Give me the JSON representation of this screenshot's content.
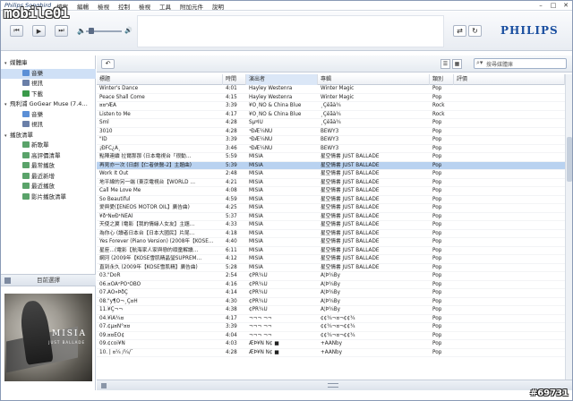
{
  "title": "Philips Songbird",
  "menu": [
    "檔案",
    "編輯",
    "檢視",
    "控制",
    "檢視",
    "工具",
    "附加元件",
    "說明"
  ],
  "watermark": "mobile01",
  "watermark_id": "#69731",
  "brand": "PHILIPS",
  "sidebar": {
    "tree": [
      {
        "label": "媒體庫",
        "level": 0,
        "expander": "▾"
      },
      {
        "label": "音樂",
        "level": 1,
        "selected": true,
        "icon_color": "#5b8fd6"
      },
      {
        "label": "視訊",
        "level": 1,
        "icon_color": "#6a7fa8"
      },
      {
        "label": "下載",
        "level": 1,
        "icon_color": "#3a9a4a"
      },
      {
        "label": "飛利浦 GoGear Muse (7.4…",
        "level": 0,
        "expander": "▾"
      },
      {
        "label": "音樂",
        "level": 1,
        "icon_color": "#5b8fd6"
      },
      {
        "label": "視訊",
        "level": 1,
        "icon_color": "#6a7fa8"
      },
      {
        "label": "播放清單",
        "level": 0,
        "expander": "▾"
      },
      {
        "label": "新歌單",
        "level": 1,
        "icon_color": "#5aa36a"
      },
      {
        "label": "高評價清單",
        "level": 1,
        "icon_color": "#5aa36a"
      },
      {
        "label": "最常播放",
        "level": 1,
        "icon_color": "#5aa36a"
      },
      {
        "label": "最近新增",
        "level": 1,
        "icon_color": "#5aa36a"
      },
      {
        "label": "最近播放",
        "level": 1,
        "icon_color": "#5aa36a"
      },
      {
        "label": "影片播放清單",
        "level": 1,
        "icon_color": "#5aa36a"
      }
    ],
    "now_selecting": "目前選擇",
    "album_text": "MISIA",
    "album_subtext": "JUST BALLADE"
  },
  "toolbar": {
    "back_label": "↶",
    "search_placeholder": "搜尋媒體庫"
  },
  "columns": [
    "標題",
    "時間",
    "演出者",
    "專輯",
    "類別",
    "評價"
  ],
  "rows": [
    [
      "Winter's Dance",
      "4:01",
      "Hayley Westenra",
      "Winter Magic",
      "Pop",
      ""
    ],
    [
      "Peace Shall Come",
      "4:15",
      "Hayley Westenra",
      "Winter Magic",
      "Pop",
      ""
    ],
    [
      "¤¤³ÆÀ",
      "3:39",
      "¥Ò¸ÑÖ & China Blue",
      "¸Çëãà¾",
      "Rock",
      ""
    ],
    [
      "Listen to Me",
      "4:17",
      "¥Ò¸ÑÖ & China Blue",
      "¸Çëãà¾",
      "Rock",
      ""
    ],
    [
      "Sml",
      "4:28",
      "SµºÎÚ",
      "¸Çëãà¾",
      "Pop",
      ""
    ],
    [
      "3010",
      "4:28",
      "¹ÐÆ¼ÑÚ",
      "BEWY3",
      "Pop",
      ""
    ],
    [
      "\"ÏD",
      "3:39",
      "¹ÐÆ¼ÑÚ",
      "BEWY3",
      "Pop",
      ""
    ],
    [
      "¡ÐFC¿Ã¸",
      "3:46",
      "¹ÐÆ¼ÑÚ",
      "BEWY3",
      "Pop",
      ""
    ],
    [
      "點陣連續 拉爾那那 (日本電視台「很動…",
      "5:59",
      "MISIA",
      "星空情書 JUST BALLADE",
      "Pop",
      ""
    ],
    [
      "再見亦一次 (日劇【仁者俠醫-2】主題曲)",
      "5:39",
      "MISIA",
      "星空情書 JUST BALLADE",
      "Pop",
      ""
    ],
    [
      "Work It Out",
      "2:48",
      "MISIA",
      "星空情書 JUST BALLADE",
      "Pop",
      ""
    ],
    [
      "地平線的另一端 (東京電視台【WORLD …",
      "4:21",
      "MISIA",
      "星空情書 JUST BALLADE",
      "Pop",
      ""
    ],
    [
      "Call Me Love Me",
      "4:08",
      "MISIA",
      "星空情書 JUST BALLADE",
      "Pop",
      ""
    ],
    [
      "So Beautiful",
      "4:59",
      "MISIA",
      "星空情書 JUST BALLADE",
      "Pop",
      ""
    ],
    [
      "爱與愛(【ENEOS MOTOR OIL】廣告曲)",
      "4:25",
      "MISIA",
      "星空情書 JUST BALLADE",
      "Pop",
      ""
    ],
    [
      "¥ð¹Ñ¤Ð¹ÑËÁÏ",
      "5:37",
      "MISIA",
      "星空情書 JUST BALLADE",
      "Pop",
      ""
    ],
    [
      "天使之翼 (電影【我的情緣人女友】主題…",
      "4:33",
      "MISIA",
      "星空情書 JUST BALLADE",
      "Pop",
      ""
    ],
    [
      "為你心 (讀者日本台【日本大國民】片尾…",
      "4:18",
      "MISIA",
      "星空情書 JUST BALLADE",
      "Pop",
      ""
    ],
    [
      "Yes Forever (Piano Version) (2008年【KOSE…",
      "4:40",
      "MISIA",
      "星空情書 JUST BALLADE",
      "Pop",
      ""
    ],
    [
      "星座…(電影【航海家人家與戀的頑童解讀…",
      "6:11",
      "MISIA",
      "星空情書 JUST BALLADE",
      "Pop",
      ""
    ],
    [
      "網河 (2009年【KOSE雪肌精晶瑩SUPREM…",
      "4:12",
      "MISIA",
      "星空情書 JUST BALLADE",
      "Pop",
      ""
    ],
    [
      "直到永久 (2009年【KOSE雪肌精】廣告曲)",
      "5:28",
      "MISIA",
      "星空情書 JUST BALLADE",
      "Pop",
      ""
    ],
    [
      "03.\"DoR",
      "2:54",
      "¢PR¾Ü",
      "Á¦Þ¾By",
      "Pop",
      ""
    ],
    [
      "06.¤ÕÀ²PÖ¹ÖBO",
      "4:16",
      "¢PR¾Ü",
      "Á¦Þ¾By",
      "Pop",
      ""
    ],
    [
      "07.ÀÖ»ÞðÇ",
      "4:14",
      "¢PR¾Ü",
      "Á¦Þ¾By",
      "Pop",
      ""
    ],
    [
      "08.\"y¶Ó¬¸Ç¤H",
      "4:30",
      "¢PR¾Ü",
      "Á¦Þ¾By",
      "Pop",
      ""
    ],
    [
      "11.¥Ç¬¬",
      "4:38",
      "¢PR¾Ü",
      "Á¦Þ¾By",
      "Pop",
      ""
    ],
    [
      "04.¥ìÁ¾¤",
      "4:17",
      "¬¬¬ ¬¬",
      "¢¢¾¬¤¬¢¢¾",
      "Pop",
      ""
    ],
    [
      "07.¢µ¤Ñ°¤¤",
      "3:39",
      "¬¬¬ ¬¬",
      "¢¢¾¬¤¬¢¢¾",
      "Pop",
      ""
    ],
    [
      "09.¤¤ËÖ¢",
      "4:04",
      "¬¬¬ ¬¬",
      "¢¢¾¬¤¬¢¢¾",
      "Pop",
      ""
    ],
    [
      "09.¢coi¥Ñ",
      "4:03",
      "ÆÞ¥Ñ Ñ¢ ■",
      "+ÀÀÑby",
      "Pop",
      ""
    ],
    [
      "10. | ¤¼ /¼/¯",
      "4:28",
      "ÆÞ¥Ñ Ñ¢ ■",
      "+ÀÀÑby",
      "Pop",
      ""
    ]
  ],
  "selected_row": 9
}
